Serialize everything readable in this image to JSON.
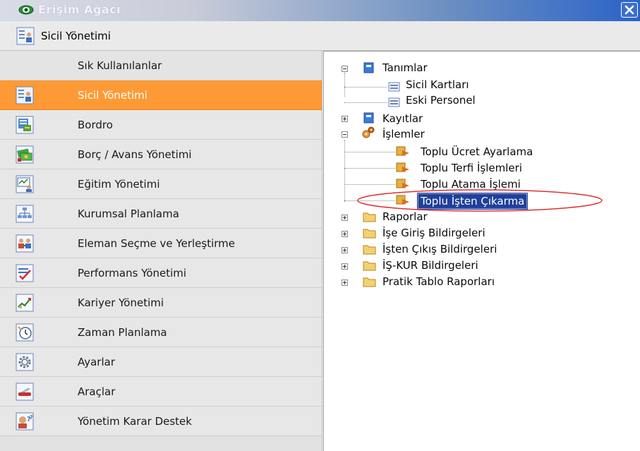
{
  "window": {
    "title": "Erişim Ağacı"
  },
  "header": {
    "title": "Sicil Yönetimi",
    "icon": "sicil-card-icon"
  },
  "nav": {
    "items": [
      {
        "label": "Sık Kullanılanlar",
        "icon": ""
      },
      {
        "label": "Sicil Yönetimi",
        "icon": "sicil-card-icon",
        "active": true
      },
      {
        "label": "Bordro",
        "icon": "payroll-icon"
      },
      {
        "label": "Borç / Avans Yönetimi",
        "icon": "money-icon"
      },
      {
        "label": "Eğitim Yönetimi",
        "icon": "training-board-icon"
      },
      {
        "label": "Kurumsal Planlama",
        "icon": "org-chart-icon"
      },
      {
        "label": "Eleman Seçme ve Yerleştirme",
        "icon": "people-icon"
      },
      {
        "label": "Performans Yönetimi",
        "icon": "checklist-icon"
      },
      {
        "label": "Kariyer Yönetimi",
        "icon": "trend-chart-icon"
      },
      {
        "label": "Zaman Planlama",
        "icon": "clock-icon"
      },
      {
        "label": "Ayarlar",
        "icon": "gear-icon"
      },
      {
        "label": "Araçlar",
        "icon": "tool-knife-icon"
      },
      {
        "label": "Yönetim Karar Destek",
        "icon": "decision-support-icon"
      }
    ]
  },
  "tree": {
    "tanimlar": "Tanımlar",
    "sicil_kartlari": "Sicil Kartları",
    "eski_personel": "Eski Personel",
    "kayitlar": "Kayıtlar",
    "islemler": "İşlemler",
    "toplu_ucret": "Toplu Ücret Ayarlama",
    "toplu_terfi": "Toplu Terfi İşlemleri",
    "toplu_atama": "Toplu Atama İşlemi",
    "toplu_isten": "Toplu İşten Çıkarma",
    "raporlar": "Raporlar",
    "ise_giris": "İşe Giriş Bildirgeleri",
    "isten_cikis": "İşten Çıkış Bildirgeleri",
    "iskur": "İŞ-KUR Bildirgeleri",
    "pratik": "Pratik Tablo Raporları"
  },
  "colors": {
    "active": "#fe9a35",
    "selection": "#1f3f9a",
    "highlight_ring": "#e03030"
  }
}
